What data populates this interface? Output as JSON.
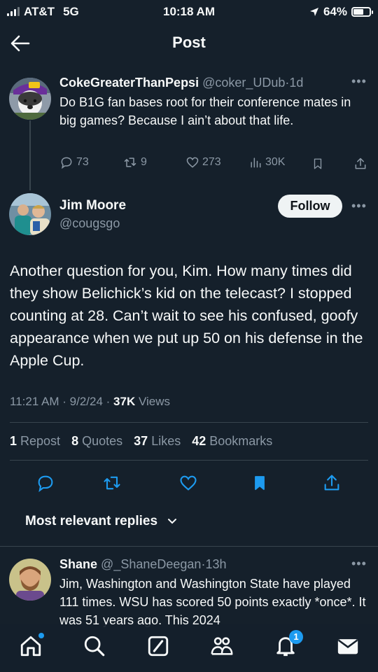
{
  "status_bar": {
    "carrier": "AT&T",
    "network": "5G",
    "time": "10:18 AM",
    "battery": "64%",
    "battery_level": 0.64
  },
  "header": {
    "title": "Post"
  },
  "parent_tweet": {
    "name": "CokeGreaterThanPepsi",
    "handle": "@coker_UDub",
    "separator": "·",
    "time": "1d",
    "text": "Do B1G fan bases root for their conference mates in big games? Because I ain’t about that life.",
    "replies": "73",
    "reposts": "9",
    "likes": "273",
    "views": "30K"
  },
  "main_tweet": {
    "name": "Jim Moore",
    "handle": "@cougsgo",
    "follow_label": "Follow",
    "text": "Another question for you, Kim. How many times did they show Belichick’s kid on the telecast? I stopped counting at 28. Can’t wait to see his confused, goofy appearance when we put up 50 on his defense in the Apple Cup.",
    "timestamp": "11:21 AM · 9/2/24 · ",
    "views_count": "37K",
    "views_label": " Views",
    "reposts_count": "1",
    "reposts_label": " Repost",
    "quotes_count": "8",
    "quotes_label": " Quotes",
    "likes_count": "37",
    "likes_label": " Likes",
    "bookmarks_count": "42",
    "bookmarks_label": " Bookmarks"
  },
  "replies_sort": {
    "label": "Most relevant replies"
  },
  "reply": {
    "name": "Shane",
    "handle": "@_ShaneDeegan",
    "separator": "·",
    "time": "13h",
    "text": "Jim, Washington and Washington State have played 111 times. WSU has scored 50 points exactly *once*. It was 51 years ago. This 2024"
  },
  "bottom_nav": {
    "notifications_badge": "1",
    "items": [
      "home-icon",
      "search-icon",
      "grok-icon",
      "communities-icon",
      "notifications-icon",
      "messages-icon"
    ]
  },
  "colors": {
    "background": "#15202b",
    "text": "#f7f9f9",
    "muted": "#8b98a5",
    "accent": "#1d9bf0",
    "divider": "#38444d"
  }
}
